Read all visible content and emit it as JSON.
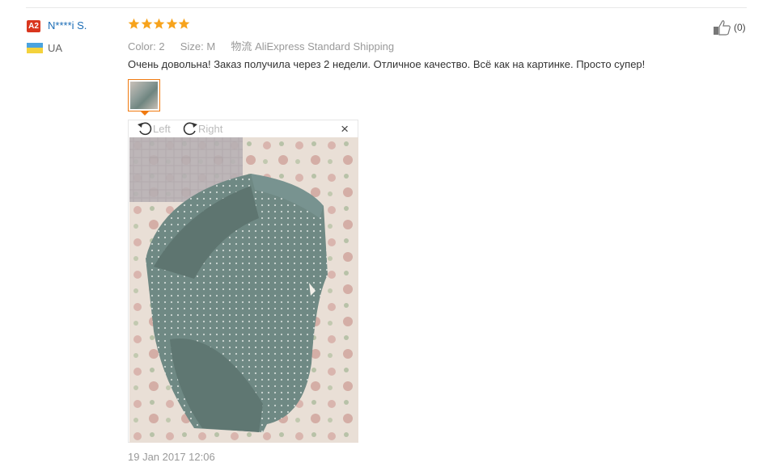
{
  "reviewer": {
    "level_badge": "A2",
    "name": "N****i S.",
    "country": "UA",
    "flag_colors": {
      "top": "#4aa3df",
      "bottom": "#f4d23c"
    }
  },
  "rating": {
    "stars": 5,
    "max": 5,
    "color": "#f7a31c"
  },
  "attributes": {
    "color_label": "Color:",
    "color_value": "2",
    "size_label": "Size:",
    "size_value": "M",
    "shipping_cn": "物流",
    "shipping_value": "AliExpress Standard Shipping"
  },
  "review_text": "Очень довольна! Заказ получила через 2 недели. Отличное качество. Всё как на картинке. Просто супер!",
  "viewer": {
    "rotate_left_label": "Left",
    "rotate_right_label": "Right",
    "close_symbol": "×",
    "accent_color": "#f07a10"
  },
  "date": "19 Jan 2017 12:06",
  "helpful": {
    "count_label": "(0)"
  },
  "icons": [
    "rotate-left-icon",
    "rotate-right-icon",
    "close-icon",
    "thumbs-up-icon",
    "star-icon"
  ]
}
